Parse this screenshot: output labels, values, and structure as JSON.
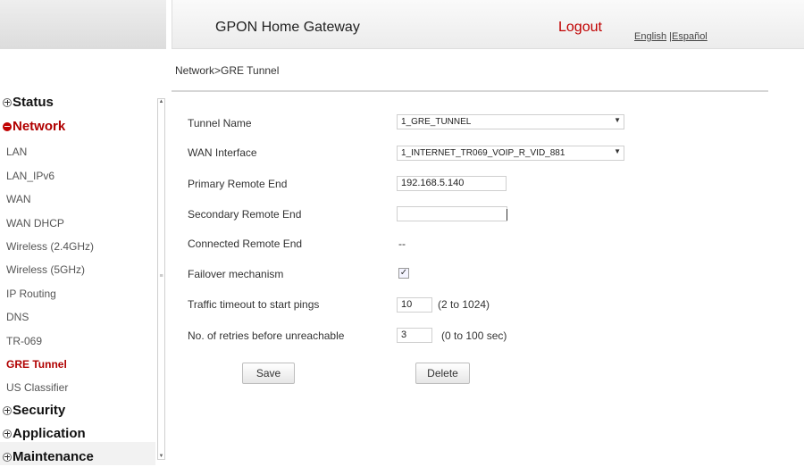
{
  "header": {
    "title": "GPON Home Gateway",
    "logout": "Logout",
    "lang_english": "English",
    "lang_separator": " |",
    "lang_spanish": "Español"
  },
  "breadcrumb": "Network>GRE Tunnel",
  "sidebar": {
    "sections": {
      "status": "Status",
      "network": "Network",
      "security": "Security",
      "application": "Application",
      "maintenance": "Maintenance"
    },
    "network_items": [
      "LAN",
      "LAN_IPv6",
      "WAN",
      "WAN DHCP",
      "Wireless (2.4GHz)",
      "Wireless (5GHz)",
      "IP Routing",
      "DNS",
      "TR-069",
      "GRE Tunnel",
      "US Classifier"
    ],
    "active_item": "GRE Tunnel"
  },
  "form": {
    "tunnel_name": {
      "label": "Tunnel Name",
      "value": "1_GRE_TUNNEL"
    },
    "wan_interface": {
      "label": "WAN Interface",
      "value": "1_INTERNET_TR069_VOIP_R_VID_881"
    },
    "primary_remote_end": {
      "label": "Primary Remote End",
      "value": "192.168.5.140"
    },
    "secondary_remote_end": {
      "label": "Secondary Remote End",
      "value": ""
    },
    "connected_remote_end": {
      "label": "Connected Remote End",
      "value": "--"
    },
    "failover_mechanism": {
      "label": "Failover mechanism",
      "checked": true,
      "mark": "✓"
    },
    "traffic_timeout": {
      "label": "Traffic timeout to start pings",
      "value": "10",
      "hint": "(2 to 1024)"
    },
    "retries": {
      "label": "No. of retries before unreachable",
      "value": "3",
      "hint": "(0 to 100 sec)"
    }
  },
  "buttons": {
    "save": "Save",
    "delete": "Delete"
  },
  "colors": {
    "accent_red": "#c00000",
    "nav_active": "#b00000"
  }
}
